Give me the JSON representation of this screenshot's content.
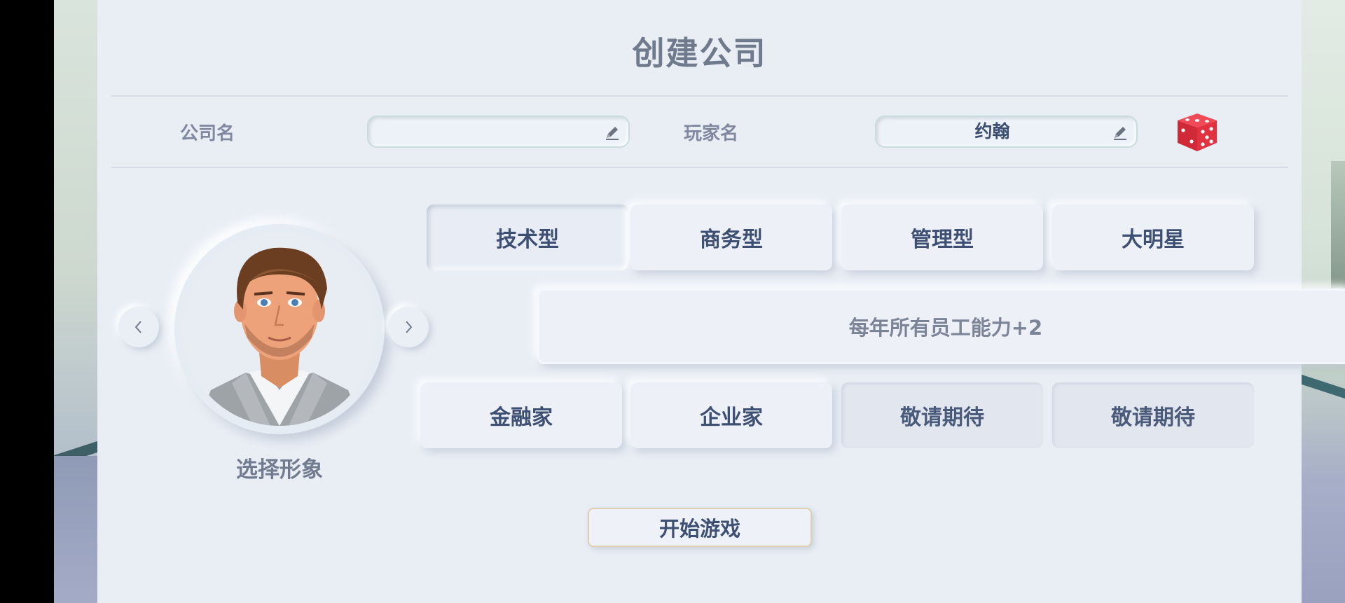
{
  "header": {
    "title": "创建公司"
  },
  "form": {
    "company_label": "公司名",
    "company_value": "",
    "player_label": "玩家名",
    "player_value": "约翰"
  },
  "avatar": {
    "label": "选择形象"
  },
  "types": [
    {
      "label": "技术型",
      "state": "selected"
    },
    {
      "label": "商务型",
      "state": "normal"
    },
    {
      "label": "管理型",
      "state": "normal"
    },
    {
      "label": "大明星",
      "state": "normal"
    },
    {
      "label": "金融家",
      "state": "normal"
    },
    {
      "label": "企业家",
      "state": "normal"
    },
    {
      "label": "敬请期待",
      "state": "disabled"
    },
    {
      "label": "敬请期待",
      "state": "disabled"
    }
  ],
  "description": "每年所有员工能力+2",
  "start_button": "开始游戏",
  "colors": {
    "panel": "#e9eef5",
    "title": "#6f7a8c",
    "button_text": "#3e4f74",
    "dice": "#e5323f"
  },
  "icons": [
    "pencil-icon",
    "dice-icon",
    "chevron-left-icon",
    "chevron-right-icon"
  ]
}
